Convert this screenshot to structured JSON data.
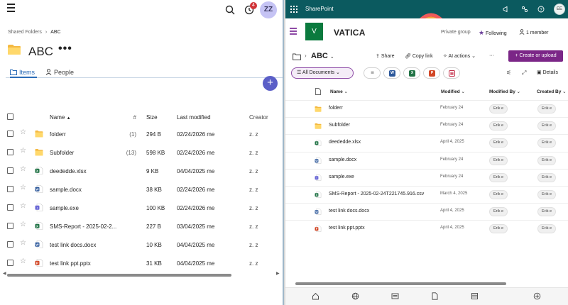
{
  "left": {
    "notification_count": "4",
    "avatar_initials": "ZZ",
    "breadcrumb": {
      "parent": "Shared Folders",
      "current": "ABC"
    },
    "title": "ABC",
    "more": "•••",
    "tabs": {
      "items": "Items",
      "people": "People"
    },
    "fab": "+",
    "headers": {
      "name": "Name",
      "count": "#",
      "size": "Size",
      "modified": "Last modified",
      "creator": "Creator"
    },
    "rows": [
      {
        "icon": "folder-icon",
        "name": "folderr",
        "count": "(1)",
        "size": "294 B",
        "modified": "02/24/2026 me",
        "creator": "z. z"
      },
      {
        "icon": "folder-icon",
        "name": "Subfolder",
        "count": "(13)",
        "size": "598 KB",
        "modified": "02/24/2026 me",
        "creator": "z. z"
      },
      {
        "icon": "excel-file-icon",
        "name": "deededde.xlsx",
        "count": "",
        "size": "9 KB",
        "modified": "04/04/2025 me",
        "creator": "z. z"
      },
      {
        "icon": "word-file-icon",
        "name": "sample.docx",
        "count": "",
        "size": "38 KB",
        "modified": "02/24/2026 me",
        "creator": "z. z"
      },
      {
        "icon": "exe-file-icon",
        "name": "sample.exe",
        "count": "",
        "size": "100 KB",
        "modified": "02/24/2026 me",
        "creator": "z. z"
      },
      {
        "icon": "csv-file-icon",
        "name": "SMS-Report - 2025-02-2...",
        "count": "",
        "size": "227 B",
        "modified": "03/04/2025 me",
        "creator": "z. z"
      },
      {
        "icon": "word-file-icon",
        "name": "test link docs.docx",
        "count": "",
        "size": "10 KB",
        "modified": "04/04/2025 me",
        "creator": "z. z"
      },
      {
        "icon": "powerpoint-file-icon",
        "name": "test link ppt.pptx",
        "count": "",
        "size": "31 KB",
        "modified": "04/04/2025 me",
        "creator": "z. z"
      }
    ]
  },
  "right": {
    "app_name": "SharePoint",
    "avatar_initials": "EE",
    "site": {
      "logo_letter": "V",
      "name": "VATICA",
      "privacy": "Private group",
      "follow": "Following",
      "members": "1 member"
    },
    "folder": "ABC",
    "commands": {
      "share": "Share",
      "copy_link": "Copy link",
      "ai_actions": "AI actions",
      "more": "···",
      "create": "Create or upload"
    },
    "view": {
      "name": "All Documents",
      "details": "Details"
    },
    "headers": {
      "name": "Name",
      "modified": "Modified",
      "modified_by": "Modified By",
      "created_by": "Created By"
    },
    "rows": [
      {
        "icon": "folder-icon",
        "name": "folderr",
        "modified": "February 24",
        "modified_by": "Erik e",
        "created_by": "Erik e"
      },
      {
        "icon": "folder-icon",
        "name": "Subfolder",
        "modified": "February 24",
        "modified_by": "Erik e",
        "created_by": "Erik e"
      },
      {
        "icon": "excel-file-icon",
        "name": "deededde.xlsx",
        "modified": "April 4, 2025",
        "modified_by": "Erik e",
        "created_by": "Erik e"
      },
      {
        "icon": "word-file-icon",
        "name": "sample.docx",
        "modified": "February 24",
        "modified_by": "Erik e",
        "created_by": "Erik e"
      },
      {
        "icon": "exe-file-icon",
        "name": "sample.exe",
        "modified": "February 24",
        "modified_by": "Erik e",
        "created_by": "Erik e"
      },
      {
        "icon": "csv-file-icon",
        "name": "SMS-Report - 2025-02-24T221745.916.csv",
        "modified": "March 4, 2025",
        "modified_by": "Erik e",
        "created_by": "Erik e"
      },
      {
        "icon": "word-file-icon",
        "name": "test link docs.docx",
        "modified": "April 4, 2025",
        "modified_by": "Erik e",
        "created_by": "Erik e"
      },
      {
        "icon": "powerpoint-file-icon",
        "name": "test link ppt.pptx",
        "modified": "April 4, 2025",
        "modified_by": "Erik e",
        "created_by": "Erik e"
      }
    ]
  },
  "colors": {
    "sp_suite": "#0b5a5f",
    "accent_purple": "#7b2687",
    "teams_purple": "#5b5fc7",
    "link_blue": "#2b6cb8",
    "site_green": "#0b7a3e"
  }
}
